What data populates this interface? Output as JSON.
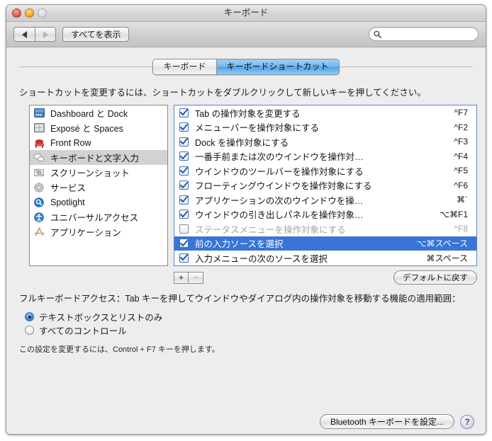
{
  "window": {
    "title": "キーボード",
    "traffic": {
      "close": "close-button",
      "minimize": "minimize-button",
      "zoom": "zoom-button"
    }
  },
  "toolbar": {
    "back_label": "◀",
    "forward_label": "▶",
    "show_all_label": "すべてを表示",
    "search_placeholder": "",
    "search_value": ""
  },
  "tabs": [
    {
      "label": "キーボード",
      "active": false
    },
    {
      "label": "キーボードショートカット",
      "active": true
    }
  ],
  "instruction": "ショートカットを変更するには、ショートカットをダブルクリックして新しいキーを押してください。",
  "sidebar": {
    "items": [
      {
        "label": "Dashboard と Dock",
        "icon": "dashboard-dock-icon",
        "selected": false
      },
      {
        "label": "Exposé と Spaces",
        "icon": "expose-spaces-icon",
        "selected": false
      },
      {
        "label": "Front Row",
        "icon": "front-row-icon",
        "selected": false
      },
      {
        "label": "キーボードと文字入力",
        "icon": "keyboard-text-input-icon",
        "selected": true
      },
      {
        "label": "スクリーンショット",
        "icon": "screenshot-icon",
        "selected": false
      },
      {
        "label": "サービス",
        "icon": "services-gear-icon",
        "selected": false
      },
      {
        "label": "Spotlight",
        "icon": "spotlight-icon",
        "selected": false
      },
      {
        "label": "ユニバーサルアクセス",
        "icon": "universal-access-icon",
        "selected": false
      },
      {
        "label": "アプリケーション",
        "icon": "applications-icon",
        "selected": false
      }
    ]
  },
  "shortcuts": {
    "rows": [
      {
        "name": "Tab の操作対象を変更する",
        "key": "^F7",
        "checked": true,
        "selected": false
      },
      {
        "name": "メニューバーを操作対象にする",
        "key": "^F2",
        "checked": true,
        "selected": false
      },
      {
        "name": "Dock を操作対象にする",
        "key": "^F3",
        "checked": true,
        "selected": false
      },
      {
        "name": "一番手前または次のウインドウを操作対…",
        "key": "^F4",
        "checked": true,
        "selected": false
      },
      {
        "name": "ウインドウのツールバーを操作対象にする",
        "key": "^F5",
        "checked": true,
        "selected": false
      },
      {
        "name": "フローティングウインドウを操作対象にする",
        "key": "^F6",
        "checked": true,
        "selected": false
      },
      {
        "name": "アプリケーションの次のウインドウを操…",
        "key": "⌘`",
        "checked": true,
        "selected": false
      },
      {
        "name": "ウインドウの引き出しパネルを操作対象…",
        "key": "⌥⌘F1",
        "checked": true,
        "selected": false
      },
      {
        "name": "ステータスメニューを操作対象にする",
        "key": "^F8",
        "checked": false,
        "selected": false
      },
      {
        "name": "前の入力ソースを選択",
        "key": "⌥⌘スペース",
        "checked": true,
        "selected": true
      },
      {
        "name": "入力メニューの次のソースを選択",
        "key": "⌘スペース",
        "checked": true,
        "selected": false
      }
    ]
  },
  "row_tools": {
    "add_label": "+",
    "remove_label": "−",
    "restore_defaults_label": "デフォルトに戻す"
  },
  "full_keyboard_access": {
    "description": "フルキーボードアクセス：Tab キーを押してウインドウやダイアログ内の操作対象を移動する機能の適用範囲：",
    "options": [
      {
        "label": "テキストボックスとリストのみ",
        "selected": true
      },
      {
        "label": "すべてのコントロール",
        "selected": false
      }
    ],
    "note": "この設定を変更するには、Control + F7 キーを押します。"
  },
  "footer": {
    "bluetooth_label": "Bluetooth キーボードを設定...",
    "help_label": "?"
  },
  "colors": {
    "selection_blue": "#3875d7",
    "tab_active_blue": "#4ea2eb",
    "sidebar_selection": "#d2d2d2",
    "list_border_focus": "#5b84c4",
    "window_bg": "#ededed"
  }
}
